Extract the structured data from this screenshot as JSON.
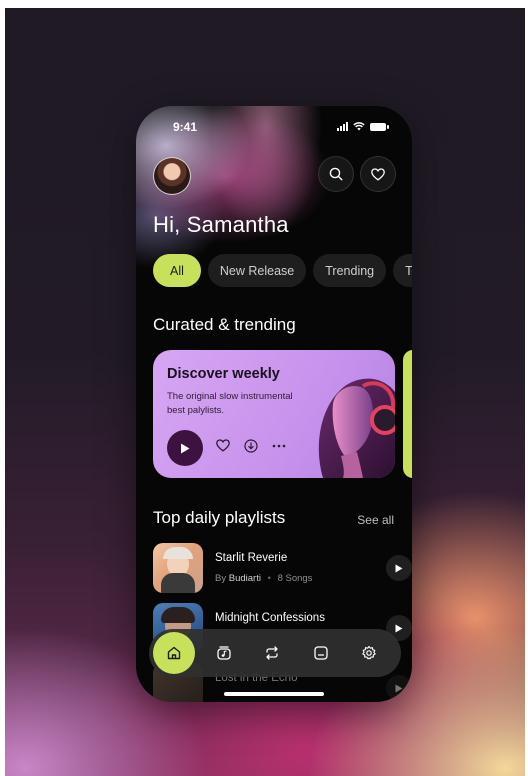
{
  "status_bar": {
    "time": "9:41"
  },
  "header": {
    "greeting": "Hi, Samantha",
    "search_icon": "search-icon",
    "favorite_icon": "heart-icon"
  },
  "filters": {
    "items": [
      "All",
      "New Release",
      "Trending",
      "Top"
    ],
    "active": "All"
  },
  "curated": {
    "title": "Curated & trending",
    "card": {
      "title": "Discover weekly",
      "description": "The original slow instrumental best palylists."
    }
  },
  "top_daily": {
    "title": "Top daily playlists",
    "see_all": "See all",
    "playlists": [
      {
        "title": "Starlit Reverie",
        "by_prefix": "By",
        "artist": "Budiarti",
        "separator": "•",
        "songs": "8 Songs"
      },
      {
        "title": "Midnight Confessions"
      },
      {
        "title": "Lost in the Echo"
      }
    ]
  },
  "bottom_nav": {
    "items": [
      "home-icon",
      "music-library-icon",
      "repeat-icon",
      "playlist-icon",
      "settings-icon"
    ],
    "active": "home-icon"
  },
  "colors": {
    "accent": "#c7e15a",
    "card": "#c792ec",
    "background": "#060606",
    "play_button": "#3d1240"
  }
}
